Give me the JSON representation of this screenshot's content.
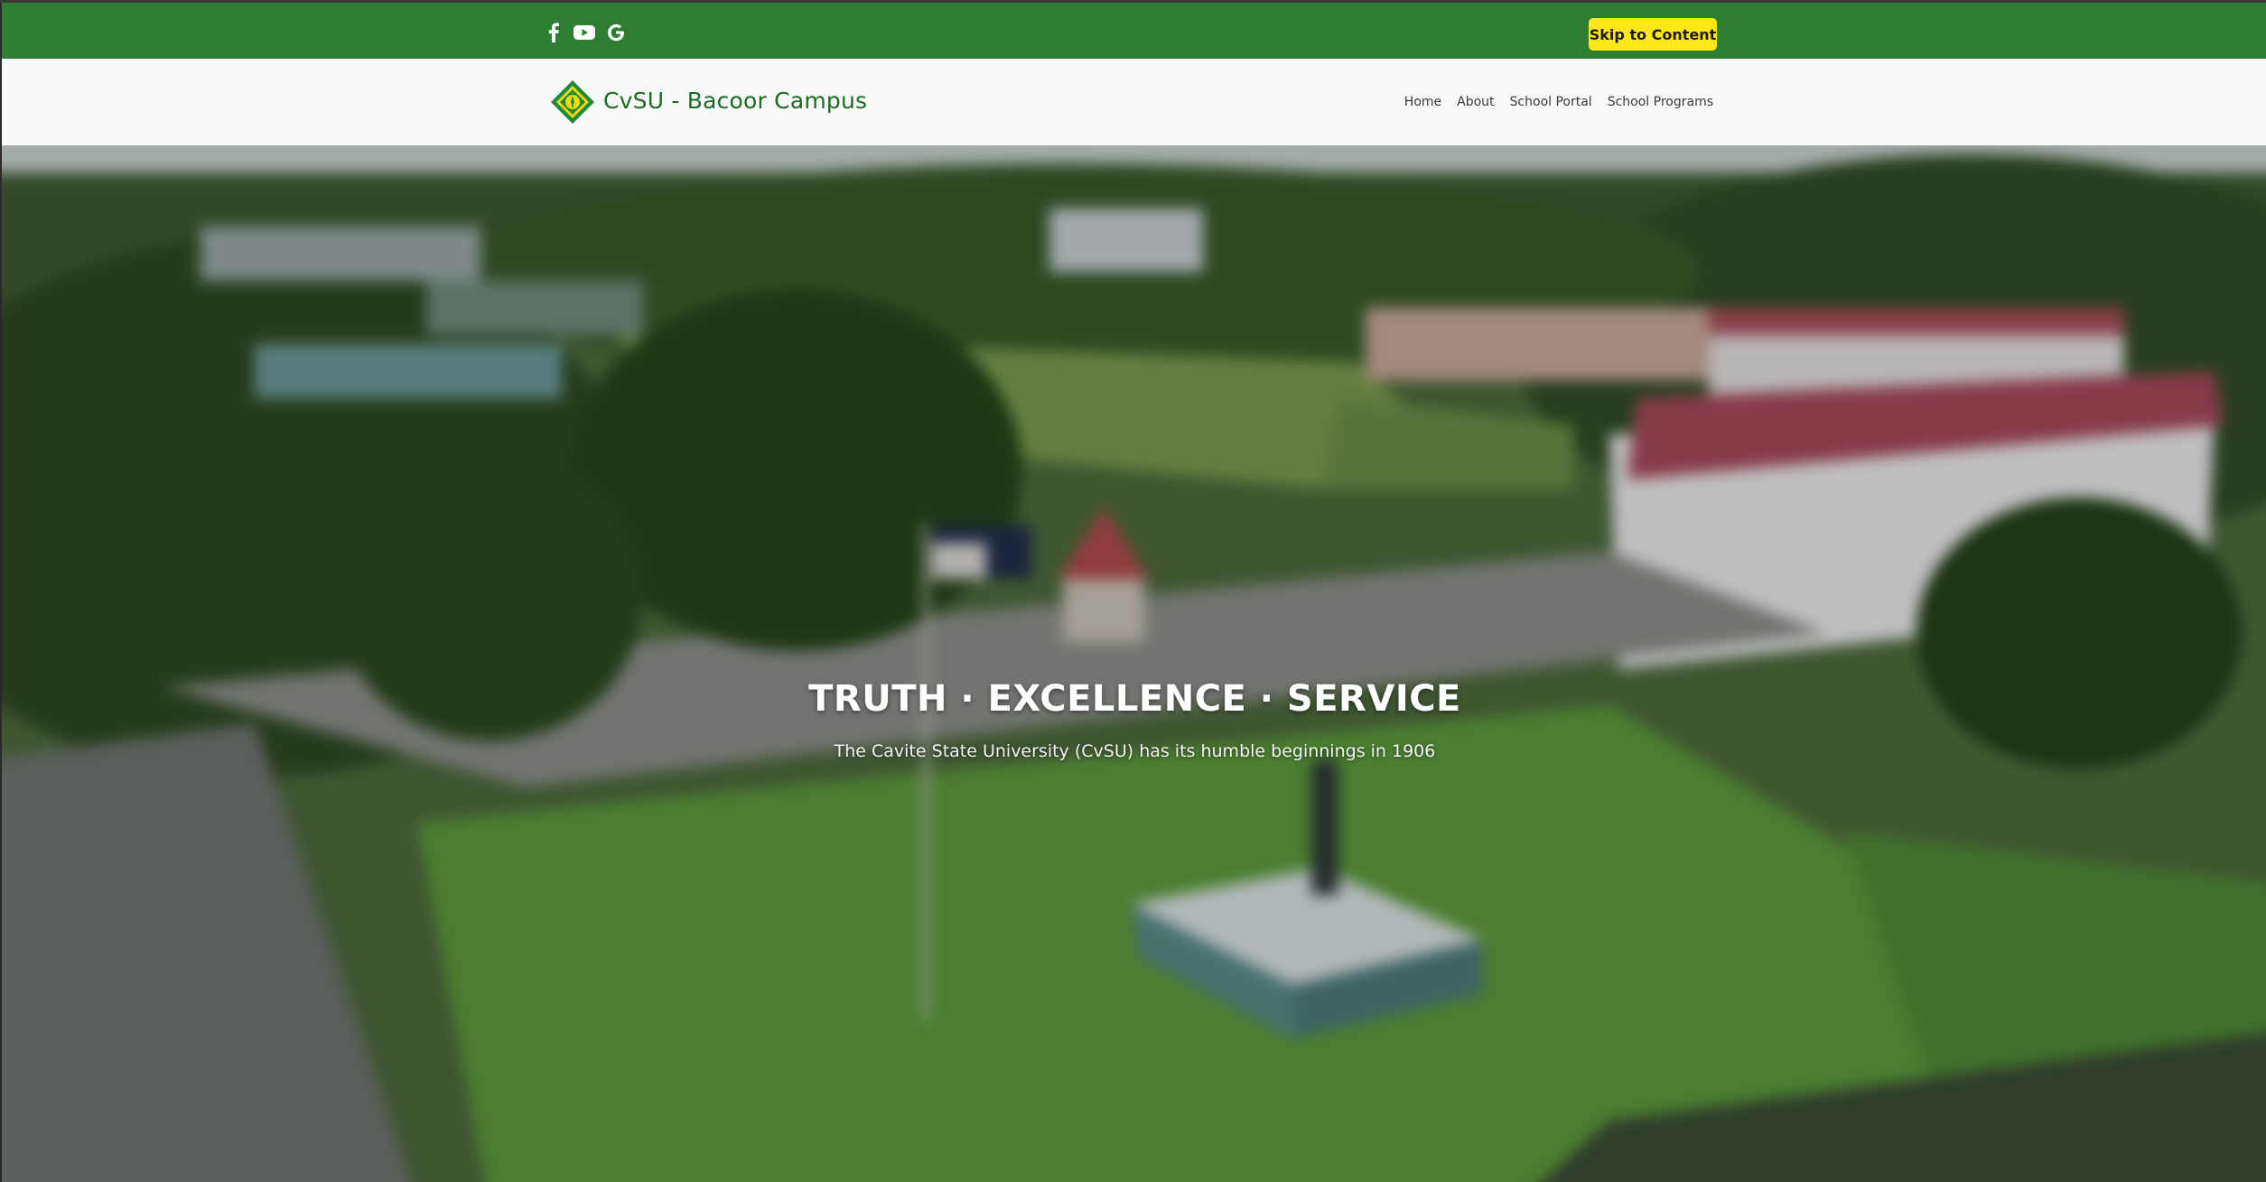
{
  "topbar": {
    "social_icons": [
      "facebook-icon",
      "youtube-icon",
      "google-icon"
    ],
    "skip_label": "Skip to Content",
    "color": "#2f7d32"
  },
  "navbar": {
    "brand": "CvSU - Bacoor Campus",
    "links": [
      "Home",
      "About",
      "School Portal",
      "School Programs"
    ],
    "brand_color": "#1f6b23"
  },
  "hero": {
    "title": "TRUTH · EXCELLENCE · SERVICE",
    "subtitle": "The Cavite State University (CvSU) has its humble beginnings in 1906"
  },
  "colors": {
    "skip_button": "#ffe81a",
    "logo_green": "#1f8a3a",
    "logo_yellow": "#f5d90a"
  }
}
